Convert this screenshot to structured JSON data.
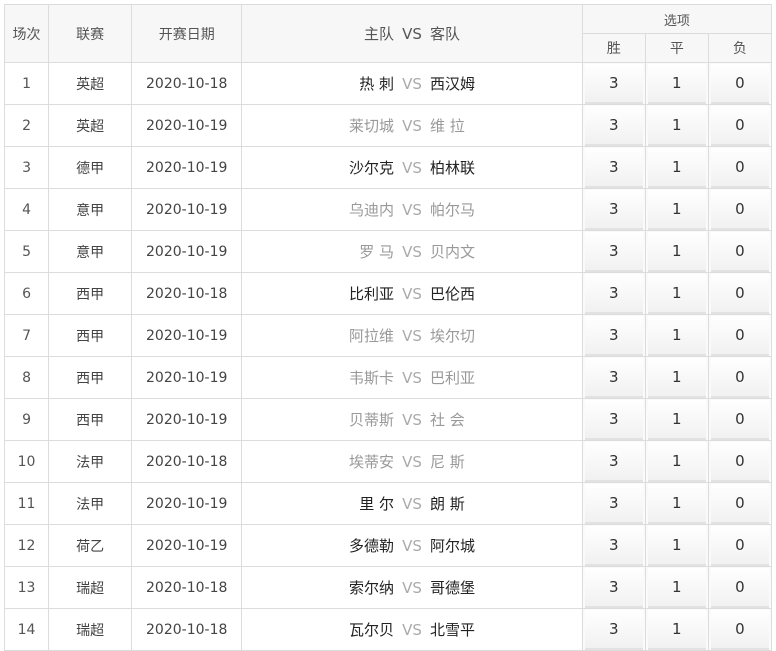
{
  "header": {
    "round": "场次",
    "league": "联赛",
    "date": "开赛日期",
    "home": "主队",
    "vs": "VS",
    "away": "客队",
    "options": "选项",
    "win": "胜",
    "draw": "平",
    "lose": "负"
  },
  "rows": [
    {
      "no": "1",
      "league": "英超",
      "date": "2020-10-18",
      "home": "热 刺",
      "away": "西汉姆",
      "tone": "dark",
      "win": "3",
      "draw": "1",
      "lose": "0"
    },
    {
      "no": "2",
      "league": "英超",
      "date": "2020-10-19",
      "home": "莱切城",
      "away": "维 拉",
      "tone": "dim",
      "win": "3",
      "draw": "1",
      "lose": "0"
    },
    {
      "no": "3",
      "league": "德甲",
      "date": "2020-10-19",
      "home": "沙尔克",
      "away": "柏林联",
      "tone": "dark",
      "win": "3",
      "draw": "1",
      "lose": "0"
    },
    {
      "no": "4",
      "league": "意甲",
      "date": "2020-10-19",
      "home": "乌迪内",
      "away": "帕尔马",
      "tone": "dim",
      "win": "3",
      "draw": "1",
      "lose": "0"
    },
    {
      "no": "5",
      "league": "意甲",
      "date": "2020-10-19",
      "home": "罗 马",
      "away": "贝内文",
      "tone": "dim",
      "win": "3",
      "draw": "1",
      "lose": "0"
    },
    {
      "no": "6",
      "league": "西甲",
      "date": "2020-10-18",
      "home": "比利亚",
      "away": "巴伦西",
      "tone": "dark",
      "win": "3",
      "draw": "1",
      "lose": "0"
    },
    {
      "no": "7",
      "league": "西甲",
      "date": "2020-10-19",
      "home": "阿拉维",
      "away": "埃尔切",
      "tone": "dim",
      "win": "3",
      "draw": "1",
      "lose": "0"
    },
    {
      "no": "8",
      "league": "西甲",
      "date": "2020-10-19",
      "home": "韦斯卡",
      "away": "巴利亚",
      "tone": "dim",
      "win": "3",
      "draw": "1",
      "lose": "0"
    },
    {
      "no": "9",
      "league": "西甲",
      "date": "2020-10-19",
      "home": "贝蒂斯",
      "away": "社 会",
      "tone": "dim",
      "win": "3",
      "draw": "1",
      "lose": "0"
    },
    {
      "no": "10",
      "league": "法甲",
      "date": "2020-10-18",
      "home": "埃蒂安",
      "away": "尼 斯",
      "tone": "dim",
      "win": "3",
      "draw": "1",
      "lose": "0"
    },
    {
      "no": "11",
      "league": "法甲",
      "date": "2020-10-19",
      "home": "里 尔",
      "away": "朗 斯",
      "tone": "dark",
      "win": "3",
      "draw": "1",
      "lose": "0"
    },
    {
      "no": "12",
      "league": "荷乙",
      "date": "2020-10-19",
      "home": "多德勒",
      "away": "阿尔城",
      "tone": "dark",
      "win": "3",
      "draw": "1",
      "lose": "0"
    },
    {
      "no": "13",
      "league": "瑞超",
      "date": "2020-10-18",
      "home": "索尔纳",
      "away": "哥德堡",
      "tone": "dark",
      "win": "3",
      "draw": "1",
      "lose": "0"
    },
    {
      "no": "14",
      "league": "瑞超",
      "date": "2020-10-18",
      "home": "瓦尔贝",
      "away": "北雪平",
      "tone": "dark",
      "win": "3",
      "draw": "1",
      "lose": "0"
    }
  ]
}
